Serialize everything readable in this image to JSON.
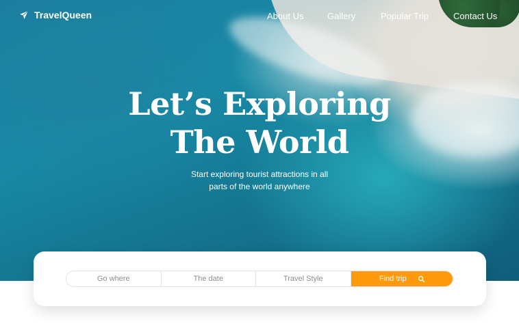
{
  "nav": {
    "brand": "TravelQueen",
    "links": [
      "About Us",
      "Gallery",
      "Popular Trip",
      "Contact Us"
    ]
  },
  "hero": {
    "title_line1": "Let’s Exploring",
    "title_line2": "The World",
    "subtitle_line1": "Start exploring tourist attractions in all",
    "subtitle_line2": "parts of the world anywhere"
  },
  "search": {
    "where_placeholder": "Go where",
    "date_placeholder": "The date",
    "style_placeholder": "Travel Style",
    "button_label": "Find trip"
  },
  "colors": {
    "accent": "#ff9a0d",
    "text_light": "#ffffff"
  },
  "icons": {
    "brand": "paper-plane-icon",
    "search": "search-icon"
  }
}
